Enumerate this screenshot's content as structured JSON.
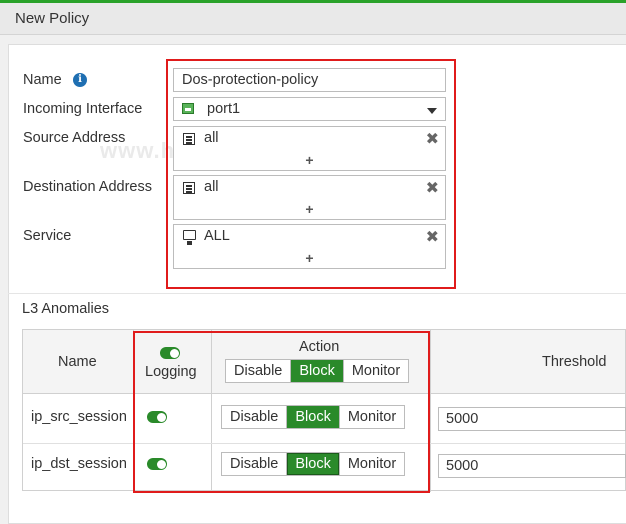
{
  "window": {
    "title": "New Policy"
  },
  "watermark": "www.hackingarticles.in",
  "form": {
    "name_label": "Name",
    "name_value": "Dos-protection-policy",
    "incoming_interface_label": "Incoming Interface",
    "incoming_interface_value": "port1",
    "source_address_label": "Source Address",
    "source_address_value": "all",
    "destination_address_label": "Destination Address",
    "destination_address_value": "all",
    "service_label": "Service",
    "service_value": "ALL",
    "add_symbol": "+",
    "remove_symbol": "✖"
  },
  "anomalies": {
    "section_title": "L3 Anomalies",
    "columns": {
      "name": "Name",
      "logging": "Logging",
      "action": "Action",
      "threshold": "Threshold"
    },
    "header_action_options": [
      "Disable",
      "Block",
      "Monitor"
    ],
    "header_action_selected": "Block",
    "rows": [
      {
        "name": "ip_src_session",
        "logging": true,
        "options": [
          "Disable",
          "Block",
          "Monitor"
        ],
        "selected": "Block",
        "threshold": "5000"
      },
      {
        "name": "ip_dst_session",
        "logging": true,
        "options": [
          "Disable",
          "Block",
          "Monitor"
        ],
        "selected": "Block",
        "threshold": "5000"
      }
    ]
  },
  "colors": {
    "accent": "#2a8a2a",
    "highlight": "#e01b1b",
    "info": "#1f6fb2"
  }
}
